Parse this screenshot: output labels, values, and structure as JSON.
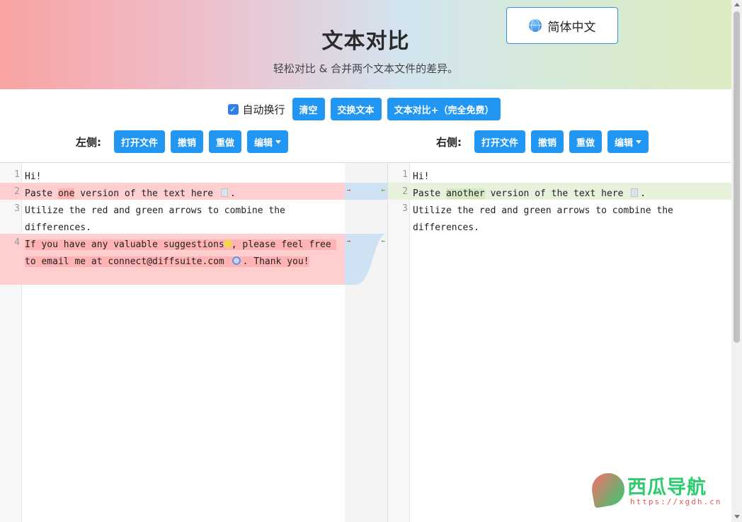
{
  "header": {
    "title": "文本对比",
    "subtitle": "轻松对比 & 合并两个文本文件的差异。",
    "language_button": "简体中文"
  },
  "toolbar": {
    "auto_wrap_label": "自动换行",
    "auto_wrap_checked": true,
    "clear_label": "清空",
    "swap_label": "交换文本",
    "plus_label": "文本对比+（完全免费）"
  },
  "left": {
    "label": "左侧:",
    "open_file": "打开文件",
    "undo": "撤销",
    "redo": "重做",
    "edit": "编辑",
    "lines": [
      {
        "num": "1",
        "text": "Hi!"
      },
      {
        "num": "2",
        "pre": "Paste ",
        "hl": "one",
        "post": " version of the text here "
      },
      {
        "num": "3",
        "text": "Utilize the red and green arrows to combine the differences."
      },
      {
        "num": "4",
        "pre": "If you have any valuable suggestions",
        "mid": ", please feel free to email me at connect@diffsuite.com ",
        "post": ". Thank you!"
      }
    ]
  },
  "right": {
    "label": "右侧:",
    "open_file": "打开文件",
    "undo": "撤销",
    "redo": "重做",
    "edit": "编辑",
    "lines": [
      {
        "num": "1",
        "text": "Hi!"
      },
      {
        "num": "2",
        "pre": "Paste ",
        "hl": "another",
        "post": " version of the text here "
      },
      {
        "num": "3",
        "text": "Utilize the red and green arrows to combine the differences."
      }
    ]
  },
  "watermark": {
    "text": "西瓜导航",
    "url": "https://xgdh.cn"
  },
  "icons": {
    "language": "globe-icon",
    "merge_right": "arrow-right-icon",
    "merge_left": "arrow-left-icon"
  },
  "colors": {
    "button": "#2196f3",
    "deleted_line": "#ffcfcf",
    "inserted_line": "#e8f1dc"
  }
}
